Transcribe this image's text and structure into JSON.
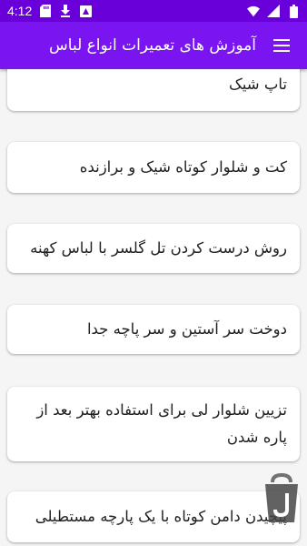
{
  "status_bar": {
    "time": "4:12",
    "left_icons": [
      "sd-card-icon",
      "download-icon",
      "news-icon"
    ],
    "right_icons": [
      "wifi-icon",
      "signal-icon",
      "battery-icon"
    ]
  },
  "app_bar": {
    "title": "آموزش های تعمیرات انواع لباس",
    "menu_icon": "hamburger-menu-icon",
    "color": "#7a14f0"
  },
  "items": [
    {
      "label": "تاپ شیک"
    },
    {
      "label": "کت و شلوار کوتاه شیک و برازنده"
    },
    {
      "label": "روش درست کردن تل گلسر با لباس کهنه"
    },
    {
      "label": "دوخت سر آستین و سر پاچه جدا"
    },
    {
      "label": "تزیین شلوار لی برای استفاده بهتر بعد از پاره شدن"
    },
    {
      "label": "پیچیدن دامن کوتاه با یک پارچه مستطیلی"
    }
  ],
  "overlay_logo": "bazaar-bag-icon"
}
